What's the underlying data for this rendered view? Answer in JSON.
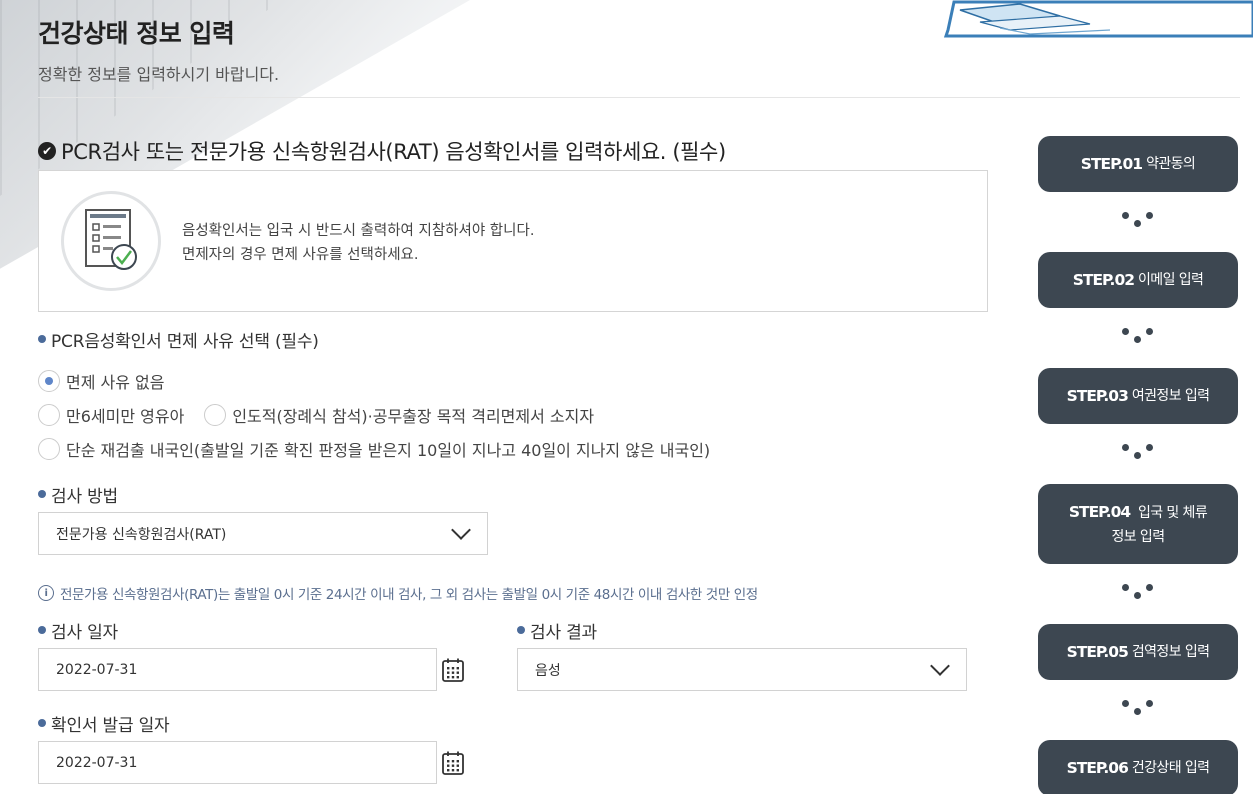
{
  "header": {
    "title": "건강상태 정보 입력",
    "subtitle": "정확한 정보를 입력하시기 바랍니다."
  },
  "section": {
    "title": "PCR검사 또는 전문가용 신속항원검사(RAT) 음성확인서를 입력하세요. (필수)",
    "notice_line1": "음성확인서는 입국 시 반드시 출력하여 지참하셔야 합니다.",
    "notice_line2": "면제자의 경우 면제 사유를 선택하세요."
  },
  "exemption": {
    "label": "PCR음성확인서 면제 사유 선택 (필수)",
    "options": [
      {
        "label": "면제 사유 없음",
        "selected": true
      },
      {
        "label": "만6세미만 영유아",
        "selected": false
      },
      {
        "label": "인도적(장례식 참석)·공무출장 목적 격리면제서 소지자",
        "selected": false
      },
      {
        "label": "단순 재검출 내국인(출발일 기준 확진 판정을 받은지 10일이 지나고 40일이 지나지 않은 내국인)",
        "selected": false
      }
    ]
  },
  "test_method": {
    "label": "검사 방법",
    "value": "전문가용 신속항원검사(RAT)",
    "info": "전문가용 신속항원검사(RAT)는 출발일 0시 기준 24시간 이내 검사, 그 외 검사는 출발일 0시 기준 48시간 이내 검사한 것만 인정"
  },
  "test_date": {
    "label": "검사 일자",
    "value": "2022-07-31"
  },
  "test_result": {
    "label": "검사 결과",
    "value": "음성"
  },
  "issue_date": {
    "label": "확인서 발급 일자",
    "value": "2022-07-31"
  },
  "steps": [
    {
      "num": "STEP.01",
      "label": "약관동의"
    },
    {
      "num": "STEP.02",
      "label": "이메일 입력"
    },
    {
      "num": "STEP.03",
      "label": "여권정보 입력"
    },
    {
      "num": "STEP.04",
      "label": "입국 및 체류 정보 입력"
    },
    {
      "num": "STEP.05",
      "label": "검역정보 입력"
    },
    {
      "num": "STEP.06",
      "label": "건강상태 입력"
    }
  ],
  "colors": {
    "step_bg": "#3d4751",
    "bullet": "#4b6b9a",
    "radio_selected": "#5f86c9",
    "info_text": "#5b6f8f"
  }
}
